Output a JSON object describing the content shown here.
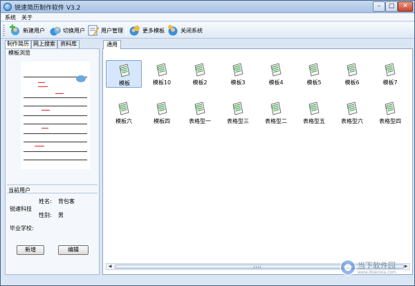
{
  "window": {
    "title": "锐速简历制作软件  V3.2"
  },
  "menu": [
    "系统",
    "关于"
  ],
  "toolbar": [
    {
      "label": "新建用户",
      "icon": "add-user-icon"
    },
    {
      "label": "切换用户",
      "icon": "switch-user-icon"
    },
    {
      "label": "用户管理",
      "icon": "user-manage-icon"
    },
    {
      "label": "更多模板",
      "icon": "more-templates-icon"
    },
    {
      "label": "关闭系统",
      "icon": "close-system-icon"
    }
  ],
  "left_tabs": [
    "制作简历",
    "网上搜索",
    "资料库"
  ],
  "preview": {
    "label": "模板浏览"
  },
  "user": {
    "section_label": "当前用户",
    "company": "锐速科技",
    "name_label": "姓名:",
    "name_value": "背包客",
    "gender_label": "性别:",
    "gender_value": "男",
    "school_label": "毕业学校:",
    "new_button": "新增",
    "edit_button": "编辑"
  },
  "right_tab": "通用",
  "templates": [
    "模板",
    "模板10",
    "模板2",
    "模板3",
    "模板4",
    "模板5",
    "模板6",
    "模板7",
    "模板六",
    "模板四",
    "表格型一",
    "表格型三",
    "表格型二",
    "表格型五",
    "表格型六",
    "表格型四"
  ],
  "selected_template": "模板",
  "watermark": {
    "text": "当下软件园",
    "sub": "www.downxia.com"
  },
  "colors": {
    "accent": "#3a7bd5",
    "selection": "#d7e7fb",
    "titlebar": "#a9c3e3"
  }
}
